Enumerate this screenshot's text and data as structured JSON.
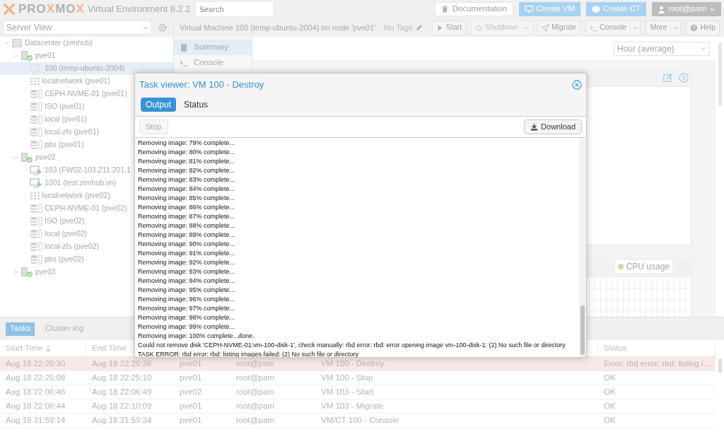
{
  "header": {
    "logo": [
      {
        "text": "PRO",
        "accent": false
      },
      {
        "text": "X",
        "accent": true
      },
      {
        "text": "MO",
        "accent": false
      },
      {
        "text": "X",
        "accent": true
      }
    ],
    "version": "Virtual Environment 8.2.2",
    "search_placeholder": "Search",
    "buttons": [
      {
        "label": "Documentation",
        "kind": "doc"
      },
      {
        "label": "Create VM",
        "kind": "vm"
      },
      {
        "label": "Create CT",
        "kind": "ct"
      }
    ],
    "user": "root@pam"
  },
  "view_selector": "Server View",
  "tree": [
    {
      "label": "Datacenter (zenhub)",
      "kind": "datacenter",
      "expanded": true,
      "selected": false,
      "children": [
        {
          "label": "pve01",
          "kind": "node",
          "expanded": true,
          "selected": false,
          "children": [
            {
              "label": "100 (temp-ubuntu-2004)",
              "kind": "vm",
              "running": false,
              "selected": true
            },
            {
              "label": "localnetwork (pve01)",
              "kind": "network",
              "selected": false
            },
            {
              "label": "CEPH-NVME-01 (pve01)",
              "kind": "storage",
              "selected": false
            },
            {
              "label": "ISO (pve01)",
              "kind": "storage",
              "selected": false
            },
            {
              "label": "local (pve01)",
              "kind": "storage",
              "selected": false
            },
            {
              "label": "local-zfs (pve01)",
              "kind": "storage",
              "selected": false
            },
            {
              "label": "pbs (pve01)",
              "kind": "storage",
              "selected": false
            }
          ]
        },
        {
          "label": "pve02",
          "kind": "node",
          "expanded": true,
          "selected": false,
          "children": [
            {
              "label": "103 (FW02-103.211.201.1",
              "kind": "vm",
              "running": true,
              "selected": false
            },
            {
              "label": "1001 (test.zenhub.vn)",
              "kind": "vm",
              "running": true,
              "selected": false
            },
            {
              "label": "localnetwork (pve02)",
              "kind": "network",
              "selected": false
            },
            {
              "label": "CEPH-NVME-01 (pve02)",
              "kind": "storage",
              "selected": false
            },
            {
              "label": "ISO (pve02)",
              "kind": "storage",
              "selected": false
            },
            {
              "label": "local (pve02)",
              "kind": "storage",
              "selected": false
            },
            {
              "label": "local-zfs (pve02)",
              "kind": "storage",
              "selected": false
            },
            {
              "label": "pbs (pve02)",
              "kind": "storage",
              "selected": false
            }
          ]
        },
        {
          "label": "pve03",
          "kind": "node",
          "expanded": false,
          "selected": false
        }
      ]
    }
  ],
  "toolbar": {
    "title": "Virtual Machine 100 (temp-ubuntu-2004) on node 'pve01'",
    "tags": "No Tags",
    "buttons": [
      {
        "label": "Start",
        "dropdown": false,
        "disabled": false
      },
      {
        "label": "Shutdown",
        "dropdown": true,
        "disabled": true
      },
      {
        "label": "Migrate",
        "dropdown": false,
        "disabled": false
      },
      {
        "label": "Console",
        "dropdown": true,
        "disabled": false
      },
      {
        "label": "More",
        "dropdown": true,
        "disabled": false
      },
      {
        "label": "Help",
        "dropdown": false,
        "disabled": false
      }
    ]
  },
  "nav": [
    {
      "label": "Summary",
      "selected": true
    },
    {
      "label": "Console",
      "selected": false
    }
  ],
  "timeframe": "Hour (average)",
  "cpu_legend": {
    "label": "CPU usage",
    "color": "#cddba6"
  },
  "bottom": {
    "tabs": [
      {
        "label": "Tasks",
        "selected": true
      },
      {
        "label": "Cluster log",
        "selected": false
      }
    ],
    "columns": [
      {
        "label": "Start Time",
        "sorted": true
      },
      {
        "label": "End Time",
        "sorted": false
      },
      {
        "label": "Status",
        "sorted": false
      }
    ],
    "rows": [
      {
        "error": true,
        "start": "Aug 18 22:25:30",
        "end": "Aug 18 22:25:36",
        "node": "pve01",
        "user": "root@pam",
        "description": "VM 100 - Destroy",
        "status": "Error: rbd error: rbd: listing i…"
      },
      {
        "error": false,
        "start": "Aug 18 22:25:08",
        "end": "Aug 18 22:25:10",
        "node": "pve01",
        "user": "root@pam",
        "description": "VM 100 - Stop",
        "status": "OK"
      },
      {
        "error": false,
        "start": "Aug 18 22:06:46",
        "end": "Aug 18 22:06:49",
        "node": "pve02",
        "user": "root@pam",
        "description": "VM 103 - Start",
        "status": "OK"
      },
      {
        "error": false,
        "start": "Aug 18 22:06:44",
        "end": "Aug 18 22:10:09",
        "node": "pve01",
        "user": "root@pam",
        "description": "VM 103 - Migrate",
        "status": "OK"
      },
      {
        "error": false,
        "start": "Aug 18 21:59:14",
        "end": "Aug 18 21:59:34",
        "node": "pve01",
        "user": "root@pam",
        "description": "VM/CT 100 - Console",
        "status": "OK"
      }
    ]
  },
  "task_viewer": {
    "title": "Task viewer: VM 100 - Destroy",
    "tabs": [
      {
        "label": "Output",
        "selected": true
      },
      {
        "label": "Status",
        "selected": false
      }
    ],
    "stop": {
      "label": "Stop",
      "disabled": true
    },
    "download": "Download",
    "log": [
      "Removing image: 79% complete...",
      "Removing image: 80% complete...",
      "Removing image: 81% complete...",
      "Removing image: 82% complete...",
      "Removing image: 83% complete...",
      "Removing image: 84% complete...",
      "Removing image: 85% complete...",
      "Removing image: 86% complete...",
      "Removing image: 87% complete...",
      "Removing image: 88% complete...",
      "Removing image: 89% complete...",
      "Removing image: 90% complete...",
      "Removing image: 91% complete...",
      "Removing image: 92% complete...",
      "Removing image: 93% complete...",
      "Removing image: 94% complete...",
      "Removing image: 95% complete...",
      "Removing image: 96% complete...",
      "Removing image: 97% complete...",
      "Removing image: 98% complete...",
      "Removing image: 99% complete...",
      "Removing image: 100% complete...done.",
      "Could not remove disk 'CEPH-NVME-01:vm-100-disk-1', check manually: rbd error: rbd: error opening image vm-100-disk-1: (2) No such file or directory",
      "TASK ERROR: rbd error: rbd: listing images failed: (2) No such file or directory"
    ]
  }
}
